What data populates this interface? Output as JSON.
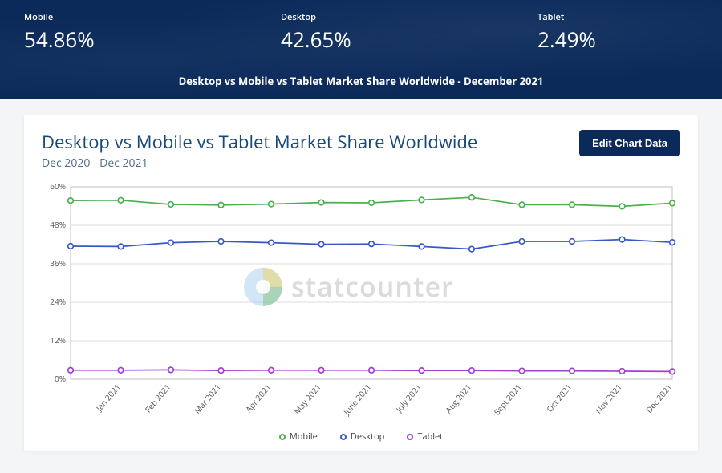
{
  "header": {
    "stats": [
      {
        "label": "Mobile",
        "value": "54.86%"
      },
      {
        "label": "Desktop",
        "value": "42.65%"
      },
      {
        "label": "Tablet",
        "value": "2.49%"
      }
    ],
    "subtitle": "Desktop vs Mobile vs Tablet Market Share Worldwide - December 2021"
  },
  "card": {
    "title": "Desktop vs Mobile vs Tablet Market Share Worldwide",
    "range": "Dec 2020 - Dec 2021",
    "button": "Edit Chart Data"
  },
  "watermark": "statcounter",
  "legend": [
    {
      "name": "Mobile",
      "color": "#4caf50"
    },
    {
      "name": "Desktop",
      "color": "#3858c9"
    },
    {
      "name": "Tablet",
      "color": "#a040d0"
    }
  ],
  "chart_data": {
    "type": "line",
    "title": "Desktop vs Mobile vs Tablet Market Share Worldwide",
    "xlabel": "",
    "ylabel": "",
    "ylim": [
      0,
      60
    ],
    "yticks": [
      0,
      12,
      24,
      36,
      48,
      60
    ],
    "ytick_labels": [
      "0%",
      "12%",
      "24%",
      "36%",
      "48%",
      "60%"
    ],
    "categories": [
      "Dec 2020",
      "Jan 2021",
      "Feb 2021",
      "Mar 2021",
      "Apr 2021",
      "May 2021",
      "June 2021",
      "July 2021",
      "Aug 2021",
      "Sept 2021",
      "Oct 2021",
      "Nov 2021",
      "Dec 2021"
    ],
    "xtick_labels": [
      "Jan 2021",
      "Feb 2021",
      "Mar 2021",
      "Apr 2021",
      "May 2021",
      "June 2021",
      "July 2021",
      "Aug 2021",
      "Sept 2021",
      "Oct 2021",
      "Nov 2021",
      "Dec 2021"
    ],
    "series": [
      {
        "name": "Mobile",
        "color": "#4caf50",
        "values": [
          55.7,
          55.8,
          54.5,
          54.3,
          54.6,
          55.1,
          55.0,
          55.9,
          56.7,
          54.4,
          54.4,
          53.9,
          54.9
        ]
      },
      {
        "name": "Desktop",
        "color": "#3858c9",
        "values": [
          41.5,
          41.4,
          42.6,
          43.0,
          42.6,
          42.1,
          42.2,
          41.4,
          40.6,
          43.0,
          43.0,
          43.6,
          42.7
        ]
      },
      {
        "name": "Tablet",
        "color": "#a040d0",
        "values": [
          2.8,
          2.8,
          2.9,
          2.7,
          2.8,
          2.8,
          2.8,
          2.7,
          2.7,
          2.6,
          2.6,
          2.5,
          2.4
        ]
      }
    ]
  }
}
